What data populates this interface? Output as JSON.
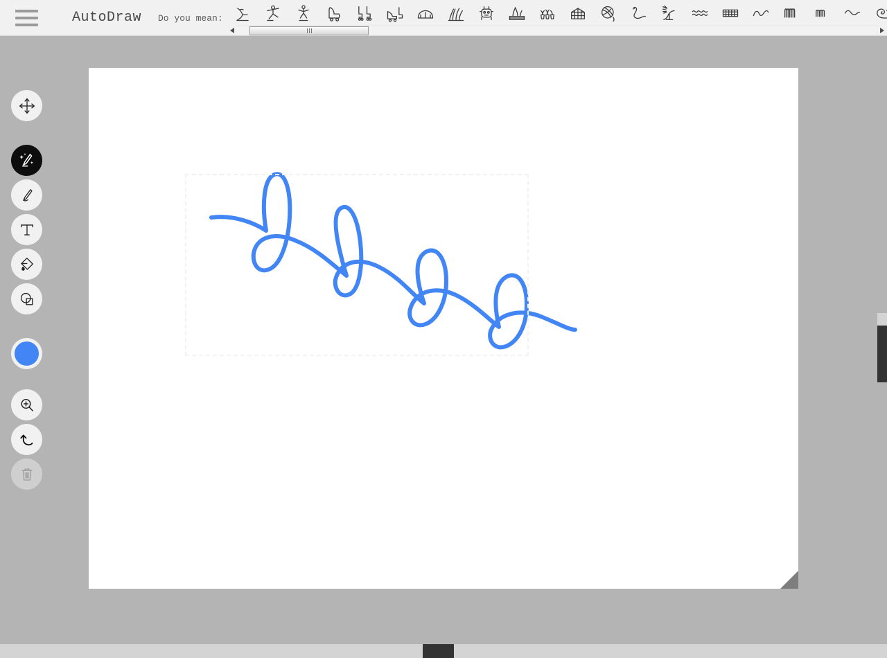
{
  "app": {
    "title": "AutoDraw",
    "suggest_label": "Do you mean:",
    "menu_icon": "hamburger-menu-icon"
  },
  "colors": {
    "accent_blue": "#4285f4",
    "stroke_blue": "#4285f4",
    "header_bg": "#f1f1f1",
    "workspace_bg": "#b4b4b4",
    "canvas_bg": "#ffffff",
    "active_tool_bg": "#0d0d0d",
    "selection_border": "#f2f2f2"
  },
  "suggestions": {
    "items": [
      {
        "name": "ice-skate-icon",
        "label": "ice skate"
      },
      {
        "name": "figure-skater-icon",
        "label": "figure skater"
      },
      {
        "name": "skater-pose-icon",
        "label": "skater"
      },
      {
        "name": "roller-skate-icon",
        "label": "roller skate"
      },
      {
        "name": "inline-skates-icon",
        "label": "inline skates"
      },
      {
        "name": "roller-skate-pair-icon",
        "label": "roller skates"
      },
      {
        "name": "skate-park-icon",
        "label": "skate park"
      },
      {
        "name": "grass-tuft-icon",
        "label": "grass"
      },
      {
        "name": "robot-icon",
        "label": "robot"
      },
      {
        "name": "garden-bed-icon",
        "label": "garden bed"
      },
      {
        "name": "potted-plants-icon",
        "label": "potted plants"
      },
      {
        "name": "greenhouse-icon",
        "label": "greenhouse"
      },
      {
        "name": "yarn-ball-icon",
        "label": "yarn ball"
      },
      {
        "name": "worm-icon",
        "label": "worm"
      },
      {
        "name": "sprinkler-icon",
        "label": "sprinkler"
      },
      {
        "name": "ripple-icon",
        "label": "ripples"
      },
      {
        "name": "ladder-icon",
        "label": "ladder"
      },
      {
        "name": "wave-curve-icon",
        "label": "wave"
      },
      {
        "name": "coil-spring-icon",
        "label": "coil spring"
      },
      {
        "name": "zigzag-spring-icon",
        "label": "spring"
      },
      {
        "name": "squiggle-icon",
        "label": "squiggle"
      },
      {
        "name": "snail-icon",
        "label": "snail"
      }
    ],
    "scrollbar": {
      "left_arrow": "scroll-left-arrow-icon",
      "right_arrow": "scroll-right-arrow-icon",
      "thumb": "suggestion-scroll-thumb"
    }
  },
  "toolbar": {
    "tools": [
      {
        "name": "move-tool",
        "label": "Move",
        "icon": "move-arrows-icon",
        "active": false,
        "disabled": false
      },
      {
        "name": "autodraw-tool",
        "label": "AutoDraw",
        "icon": "magic-pencil-icon",
        "active": true,
        "disabled": false
      },
      {
        "name": "draw-tool",
        "label": "Draw",
        "icon": "pencil-icon",
        "active": false,
        "disabled": false
      },
      {
        "name": "text-tool",
        "label": "Text",
        "icon": "text-t-icon",
        "active": false,
        "disabled": false
      },
      {
        "name": "fill-tool",
        "label": "Fill",
        "icon": "paint-bucket-icon",
        "active": false,
        "disabled": false
      },
      {
        "name": "shape-tool",
        "label": "Shape",
        "icon": "shapes-icon",
        "active": false,
        "disabled": false
      }
    ],
    "color_swatch": {
      "name": "color-swatch",
      "label": "Color",
      "value": "#4285f4"
    },
    "utilities": [
      {
        "name": "zoom-tool",
        "label": "Zoom",
        "icon": "magnifier-plus-icon",
        "disabled": false
      },
      {
        "name": "undo-button",
        "label": "Undo",
        "icon": "undo-arrow-icon",
        "disabled": false
      },
      {
        "name": "delete-button",
        "label": "Delete",
        "icon": "trash-can-icon",
        "disabled": true
      }
    ]
  },
  "canvas": {
    "drawing_name": "blue-looped-squiggle",
    "stroke_color": "#4285f4",
    "stroke_width": 6,
    "selection": {
      "name": "selection-bounding-box",
      "visible": true
    }
  }
}
